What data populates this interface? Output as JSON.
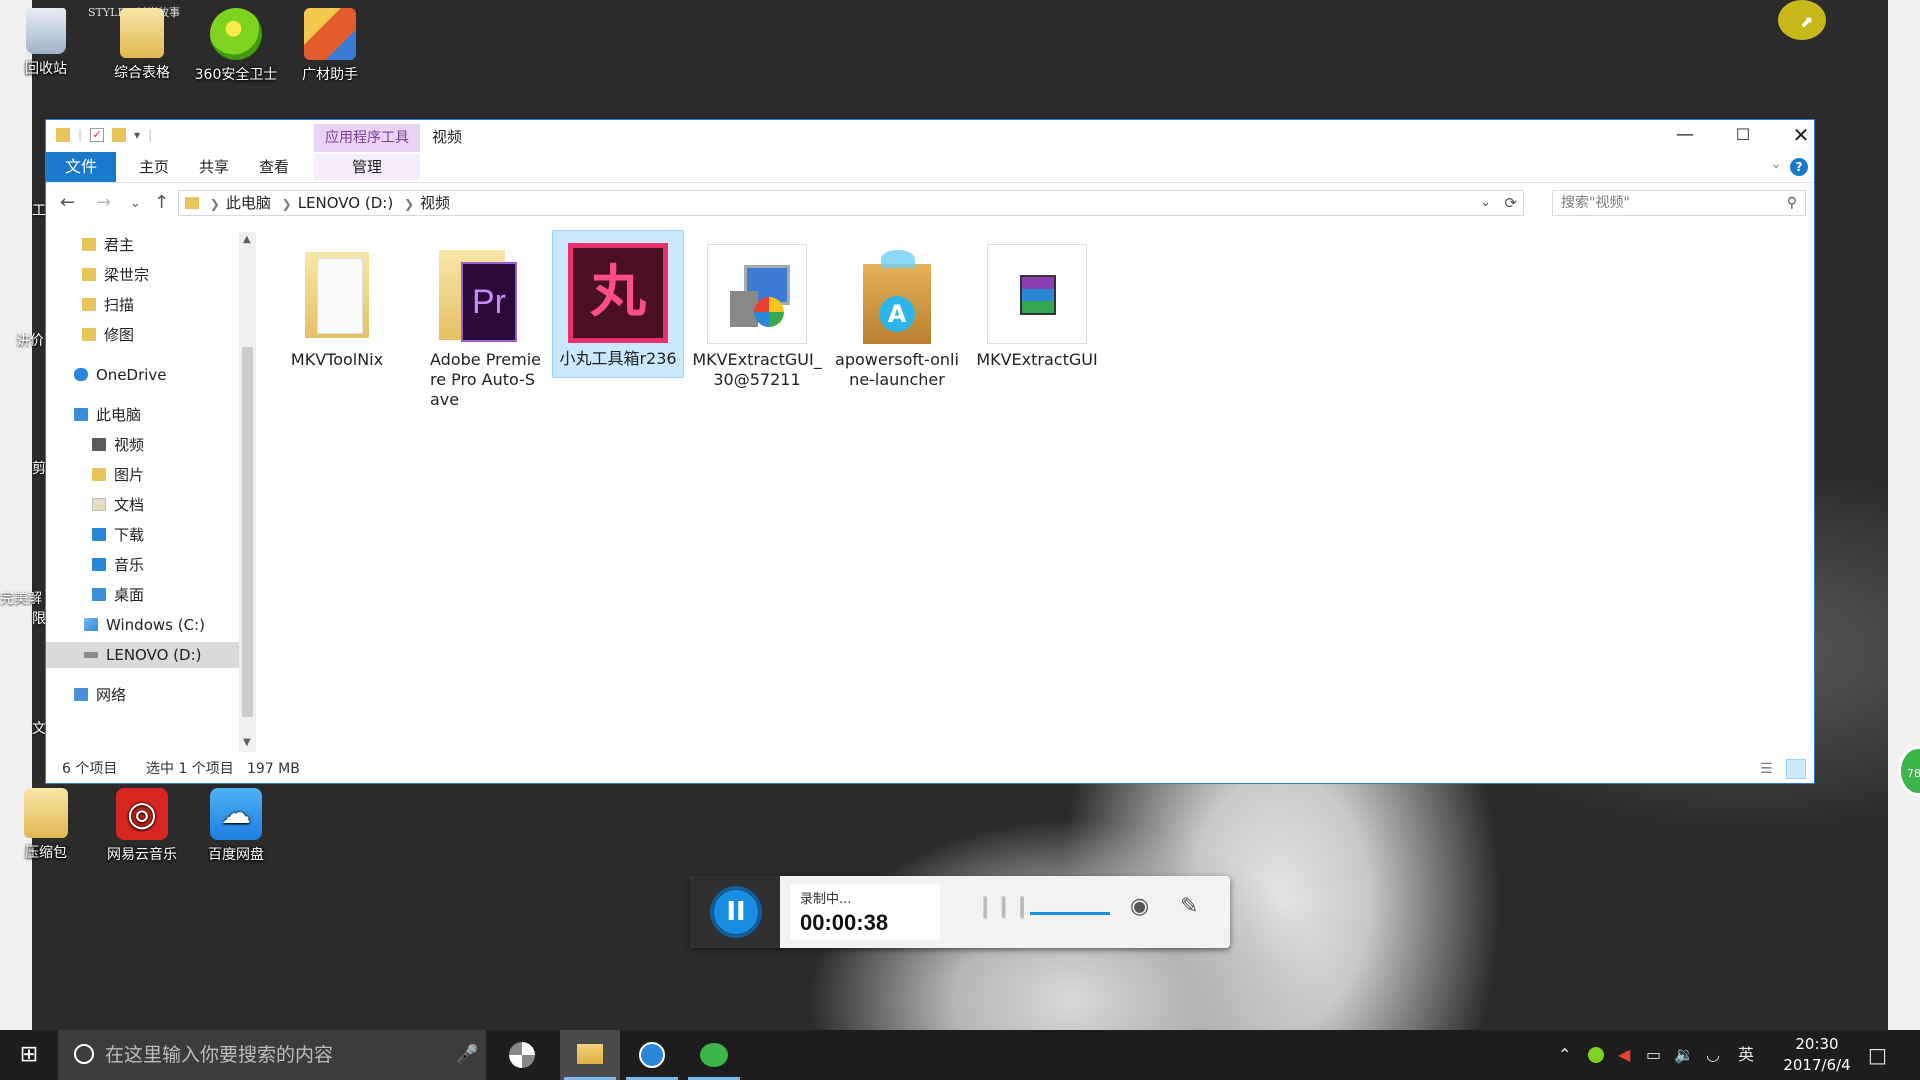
{
  "desktop": {
    "icons_top": [
      {
        "label": "回收站",
        "icon": "recycle-bin-icon"
      },
      {
        "label": "综合表格",
        "icon": "folder-icon"
      },
      {
        "label": "360安全卫士",
        "icon": "360-safe-icon"
      },
      {
        "label": "广材助手",
        "icon": "guangcai-assistant-icon"
      }
    ],
    "icons_bottom": [
      {
        "label": "压缩包",
        "icon": "zip-folder-icon"
      },
      {
        "label": "网易云音乐",
        "icon": "netease-music-icon"
      },
      {
        "label": "百度网盘",
        "icon": "baidu-netdisk-icon"
      }
    ],
    "left_partial_labels": [
      "工",
      "讲价",
      "剪",
      "完美解",
      "限",
      "文"
    ],
    "top_caption": "STYLE / 时尚故事",
    "side_badge": "78"
  },
  "explorer": {
    "title": "视频",
    "context_tab": "应用程序工具",
    "ribbon_tabs": [
      "文件",
      "主页",
      "共享",
      "查看",
      "管理"
    ],
    "breadcrumb": [
      "此电脑",
      "LENOVO (D:)",
      "视频"
    ],
    "search_placeholder": "搜索\"视频\"",
    "nav_items": [
      {
        "label": "君主",
        "icon": "folder-icon"
      },
      {
        "label": "梁世宗",
        "icon": "folder-icon"
      },
      {
        "label": "扫描",
        "icon": "folder-icon"
      },
      {
        "label": "修图",
        "icon": "folder-icon"
      },
      {
        "label": "OneDrive",
        "icon": "onedrive-icon"
      },
      {
        "label": "此电脑",
        "icon": "this-pc-icon"
      },
      {
        "label": "视频",
        "icon": "videos-folder-icon"
      },
      {
        "label": "图片",
        "icon": "pictures-folder-icon"
      },
      {
        "label": "文档",
        "icon": "documents-folder-icon"
      },
      {
        "label": "下载",
        "icon": "downloads-folder-icon"
      },
      {
        "label": "音乐",
        "icon": "music-folder-icon"
      },
      {
        "label": "桌面",
        "icon": "desktop-folder-icon"
      },
      {
        "label": "Windows (C:)",
        "icon": "windows-drive-icon"
      },
      {
        "label": "LENOVO (D:)",
        "icon": "drive-icon"
      },
      {
        "label": "网络",
        "icon": "network-icon"
      }
    ],
    "files": [
      {
        "name": "MKVToolNix",
        "icon": "folder-icon",
        "selected": false
      },
      {
        "name": "Adobe Premiere Pro Auto-Save",
        "icon": "premiere-folder-icon",
        "selected": false
      },
      {
        "name": "小丸工具箱r236",
        "icon": "xiaowan-toolbox-icon",
        "selected": true
      },
      {
        "name": "MKVExtractGUI_30@57211",
        "icon": "installer-icon",
        "selected": false
      },
      {
        "name": "apowersoft-online-launcher",
        "icon": "apowersoft-box-icon",
        "selected": false
      },
      {
        "name": "MKVExtractGUI",
        "icon": "winrar-archive-icon",
        "selected": false
      }
    ],
    "status": {
      "count": "6 个项目",
      "selection": "选中 1 个项目",
      "size": "197 MB"
    }
  },
  "recorder": {
    "status": "录制中...",
    "time": "00:00:38"
  },
  "taskbar": {
    "search_placeholder": "在这里输入你要搜索的内容",
    "ime": "英",
    "time": "20:30",
    "date": "2017/6/4"
  }
}
